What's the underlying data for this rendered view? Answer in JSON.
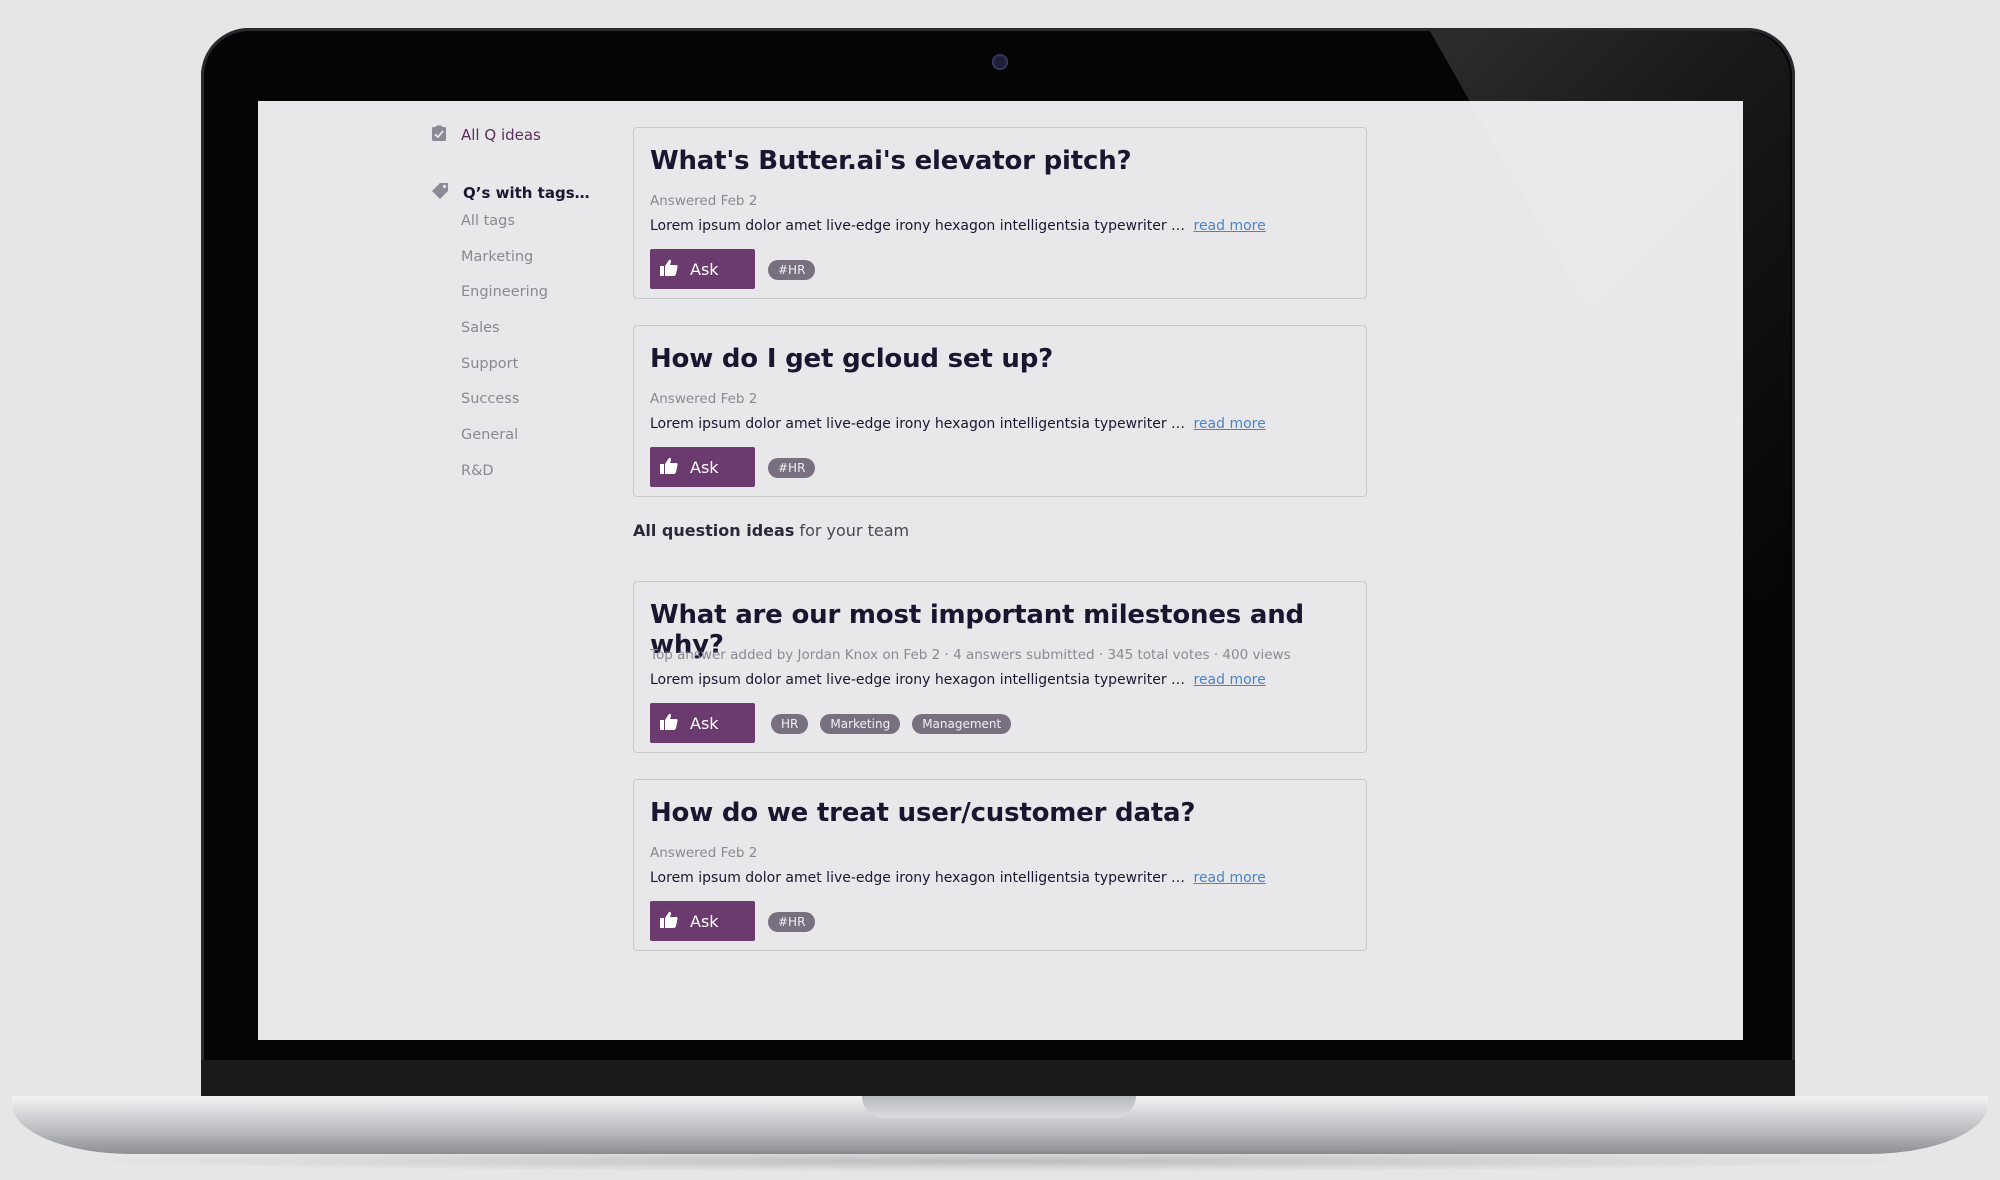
{
  "sidebar": {
    "all_ideas": "All Q ideas",
    "tags_heading": "Q’s with tags…",
    "tags": [
      "All tags",
      "Marketing",
      "Engineering",
      "Sales",
      "Support",
      "Success",
      "General",
      "R&D"
    ]
  },
  "cards_top": [
    {
      "title": "What's Butter.ai's elevator pitch?",
      "meta": "Answered Feb 2",
      "excerpt": "Lorem ipsum dolor amet live-edge irony hexagon intelligentsia typewriter …",
      "read_more": "read more",
      "ask": "Ask",
      "tags": [
        "#HR"
      ]
    },
    {
      "title": "How do I get gcloud set up?",
      "meta": "Answered Feb 2",
      "excerpt": "Lorem ipsum dolor amet live-edge irony hexagon intelligentsia typewriter …",
      "read_more": "read more",
      "ask": "Ask",
      "tags": [
        "#HR"
      ]
    }
  ],
  "section": {
    "bold": "All question ideas",
    "rest": " for your team"
  },
  "cards_bottom": [
    {
      "title": "What are our most important milestones and why?",
      "meta": "Top answer added by Jordan Knox on Feb 2 · 4 answers submitted · 345 total votes · 400 views",
      "excerpt": "Lorem ipsum dolor amet live-edge irony hexagon intelligentsia typewriter …",
      "read_more": "read more",
      "ask": "Ask",
      "tags": [
        "HR",
        "Marketing",
        "Management"
      ]
    },
    {
      "title": "How do we treat user/customer data?",
      "meta": "Answered Feb 2",
      "excerpt": "Lorem ipsum dolor amet live-edge irony hexagon intelligentsia typewriter …",
      "read_more": "read more",
      "ask": "Ask",
      "tags": [
        "#HR"
      ]
    }
  ],
  "colors": {
    "accent": "#6b3a6e",
    "tag_bg": "#79707f",
    "link": "#4b85c7",
    "title": "#1a1630"
  },
  "icons": {
    "ideas": "clipboard-icon",
    "tags": "tag-icon",
    "ask": "thumbs-up-icon"
  }
}
